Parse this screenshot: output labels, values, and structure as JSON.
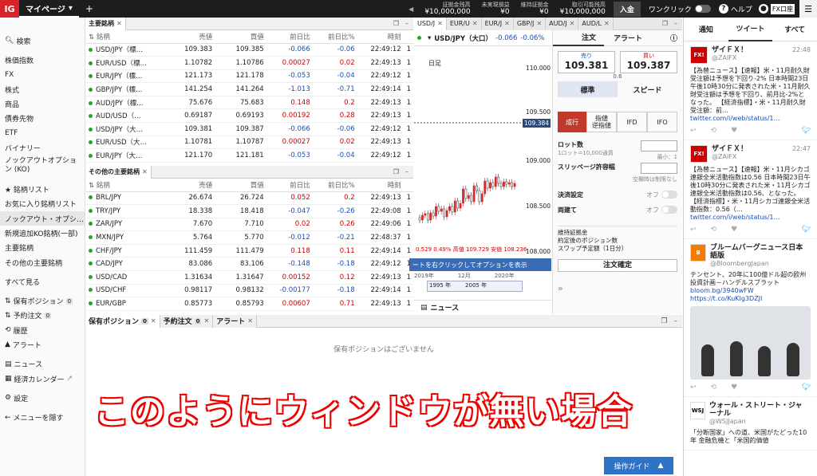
{
  "topbar": {
    "logo": "IG",
    "mypage": "マイページ",
    "plus": "+",
    "stats": [
      {
        "label": "証拠金残高",
        "value": "¥10,000,000"
      },
      {
        "label": "未実現損益",
        "value": "¥0"
      },
      {
        "label": "維持証拠金",
        "value": "¥0"
      },
      {
        "label": "取引可能残高",
        "value": "¥10,000,000"
      }
    ],
    "deposit": "入金",
    "oneclick": "ワンクリック",
    "help": "ヘルプ",
    "account": "FX口座"
  },
  "sidebar": {
    "items": [
      "株価指数",
      "FX",
      "株式",
      "商品",
      "債券先物",
      "ETF",
      "バイナリー",
      "ノックアウトオプション (KO)"
    ],
    "search": "検索",
    "lists": [
      "★ 銘柄リスト",
      "お気に入り銘柄リスト",
      "ノックアウト・オプシ…",
      "新規追加KO銘柄(一部)",
      "主要銘柄",
      "その他の主要銘柄"
    ],
    "more": "すべて見る",
    "positions": "保有ポジション",
    "positions_count": "0",
    "orders": "予約注文",
    "orders_count": "0",
    "history": "履歴",
    "alerts": "アラート",
    "news": "ニュース",
    "calendar": "経済カレンダー",
    "settings": "設定",
    "hide_menu": "メニューを隠す"
  },
  "major": {
    "tab": "主要銘柄",
    "headers": [
      "銘柄",
      "売値",
      "買値",
      "前日比",
      "前日比%",
      "時刻"
    ],
    "rows": [
      [
        "USD/JPY（標…",
        "109.383",
        "109.385",
        "-0.066",
        "-0.06",
        "22:49:12",
        "1"
      ],
      [
        "EUR/USD（標…",
        "1.10782",
        "1.10786",
        "0.00027",
        "0.02",
        "22:49:13",
        "1"
      ],
      [
        "EUR/JPY（標…",
        "121.173",
        "121.178",
        "-0.053",
        "-0.04",
        "22:49:12",
        "1"
      ],
      [
        "GBP/JPY（標…",
        "141.254",
        "141.264",
        "-1.013",
        "-0.71",
        "22:49:14",
        "1"
      ],
      [
        "AUD/JPY（標…",
        "75.676",
        "75.683",
        "0.148",
        "0.2",
        "22:49:13",
        "1"
      ],
      [
        "AUD/USD（…",
        "0.69187",
        "0.69193",
        "0.00192",
        "0.28",
        "22:49:13",
        "1"
      ],
      [
        "USD/JPY（大…",
        "109.381",
        "109.387",
        "-0.066",
        "-0.06",
        "22:49:12",
        "1"
      ],
      [
        "EUR/USD（大…",
        "1.10781",
        "1.10787",
        "0.00027",
        "0.02",
        "22:49:13",
        "1"
      ],
      [
        "EUR/JPY（大…",
        "121.170",
        "121.181",
        "-0.053",
        "-0.04",
        "22:49:12",
        "1"
      ]
    ]
  },
  "other": {
    "tab": "その他の主要銘柄",
    "headers": [
      "銘柄",
      "売値",
      "買値",
      "前日比",
      "前日比%",
      "時刻"
    ],
    "rows": [
      [
        "BRL/JPY",
        "26.674",
        "26.724",
        "0.052",
        "0.2",
        "22:49:13",
        "1"
      ],
      [
        "TRY/JPY",
        "18.338",
        "18.418",
        "-0.047",
        "-0.26",
        "22:49:08",
        "1"
      ],
      [
        "ZAR/JPY",
        "7.670",
        "7.710",
        "0.02",
        "0.26",
        "22:49:06",
        "1"
      ],
      [
        "MXN/JPY",
        "5.764",
        "5.770",
        "-0.012",
        "-0.21",
        "22:48:37",
        "1"
      ],
      [
        "CHF/JPY",
        "111.459",
        "111.479",
        "0.118",
        "0.11",
        "22:49:14",
        "1"
      ],
      [
        "CAD/JPY",
        "83.086",
        "83.106",
        "-0.148",
        "-0.18",
        "22:49:12",
        "1"
      ],
      [
        "USD/CAD",
        "1.31634",
        "1.31647",
        "0.00152",
        "0.12",
        "22:49:13",
        "1"
      ],
      [
        "USD/CHF",
        "0.98117",
        "0.98132",
        "-0.00177",
        "-0.18",
        "22:49:14",
        "1"
      ],
      [
        "EUR/GBP",
        "0.85773",
        "0.85793",
        "0.00607",
        "0.71",
        "22:49:13",
        "1"
      ]
    ]
  },
  "chart": {
    "tabs": [
      "USD/J",
      "EUR/U",
      "EUR/J",
      "GBP/J",
      "AUD/J",
      "AUD/L"
    ],
    "symbol": "USD/JPY（大口）",
    "change": "-0.066",
    "pct": "-0.06%",
    "period": "日足",
    "yticks": [
      "110.000",
      "109.500",
      "109.000",
      "108.500",
      "108.000"
    ],
    "price_tag": "109.384",
    "footer": "0.529  0.49%  高値 109.729  安値 108.236",
    "hint": "ートを右クリックしてオプションを表示",
    "xlabels": [
      "2019年",
      "12月",
      "2020年"
    ],
    "nav_labels": [
      "1995 年",
      "2005 年"
    ],
    "news": "ニュース"
  },
  "order": {
    "tabs": [
      "注文",
      "アラート"
    ],
    "sell_label": "売り",
    "sell_price": "109.381",
    "buy_label": "買い",
    "buy_price": "109.387",
    "spread": "0.6",
    "modes": [
      "標準",
      "スピード"
    ],
    "types": [
      "成行",
      "指値\n逆指値",
      "IFD",
      "IFO"
    ],
    "lot": "ロット数",
    "lot_hint": "1ロット=10,000通貨",
    "lot_min": "最小：1",
    "slip": "スリッページ許容幅",
    "slip_hint": "空欄時は制限なし",
    "settle": "決済設定",
    "settle_val": "オフ",
    "both": "両建て",
    "both_val": "オフ",
    "margin": "維持証拠金",
    "positions": "約定後のポジション数",
    "swap": "スワップ予定額（1日分）",
    "confirm": "注文確定"
  },
  "bottom": {
    "tabs": [
      {
        "label": "保有ポジション",
        "count": "0"
      },
      {
        "label": "予約注文",
        "count": "0"
      },
      {
        "label": "アラート"
      }
    ],
    "empty": "保有ポジションはございません",
    "guide": "操作ガイド"
  },
  "right": {
    "tabs": [
      "通知",
      "ツイート",
      "すべて"
    ],
    "tweets": [
      {
        "name": "ザイＦＸ！",
        "handle": "@ZAIFX",
        "time": "22:48",
        "body": "【為替ニュース】【速報】米・11月耐久財受注額は予想を下回り-2% 日本時間23日午後10時30分に発表された米・11月耐久財受注額は予想を下回り、前月比-2%となった。 【経済指標】・米・11月耐久財受注額：前…",
        "link": "twitter.com/i/web/status/1…"
      },
      {
        "name": "ザイＦＸ！",
        "handle": "@ZAIFX",
        "time": "22:47",
        "body": "【為替ニュース】【速報】米・11月シカゴ連銀全米活動指数は0.56 日本時間23日午後10時30分に発表された米・11月シカゴ連銀全米活動指数は0.56、となった。 【経済指標】・米・11月シカゴ連銀全米活動指数：0.56（…",
        "link": "twitter.com/i/web/status/1…"
      },
      {
        "name": "ブルームバーグニュース日本語版",
        "handle": "@BloombergJapan",
        "time": "",
        "body": "テンセント、20年に100億ドル超の欧州投資計画－ハンデルスブラット",
        "link": "bloom.bg/3940wFW\nhttps://t.co/KuKIg3DZJI"
      },
      {
        "name": "ウォール・ストリート・ジャーナル",
        "handle": "@WSJJapan",
        "time": "",
        "body": "「分断国家」への道、米国がたどった10年 金融危機と「米国的価値",
        "link": ""
      }
    ]
  },
  "overlay": "このようにウィンドウが無い場合"
}
